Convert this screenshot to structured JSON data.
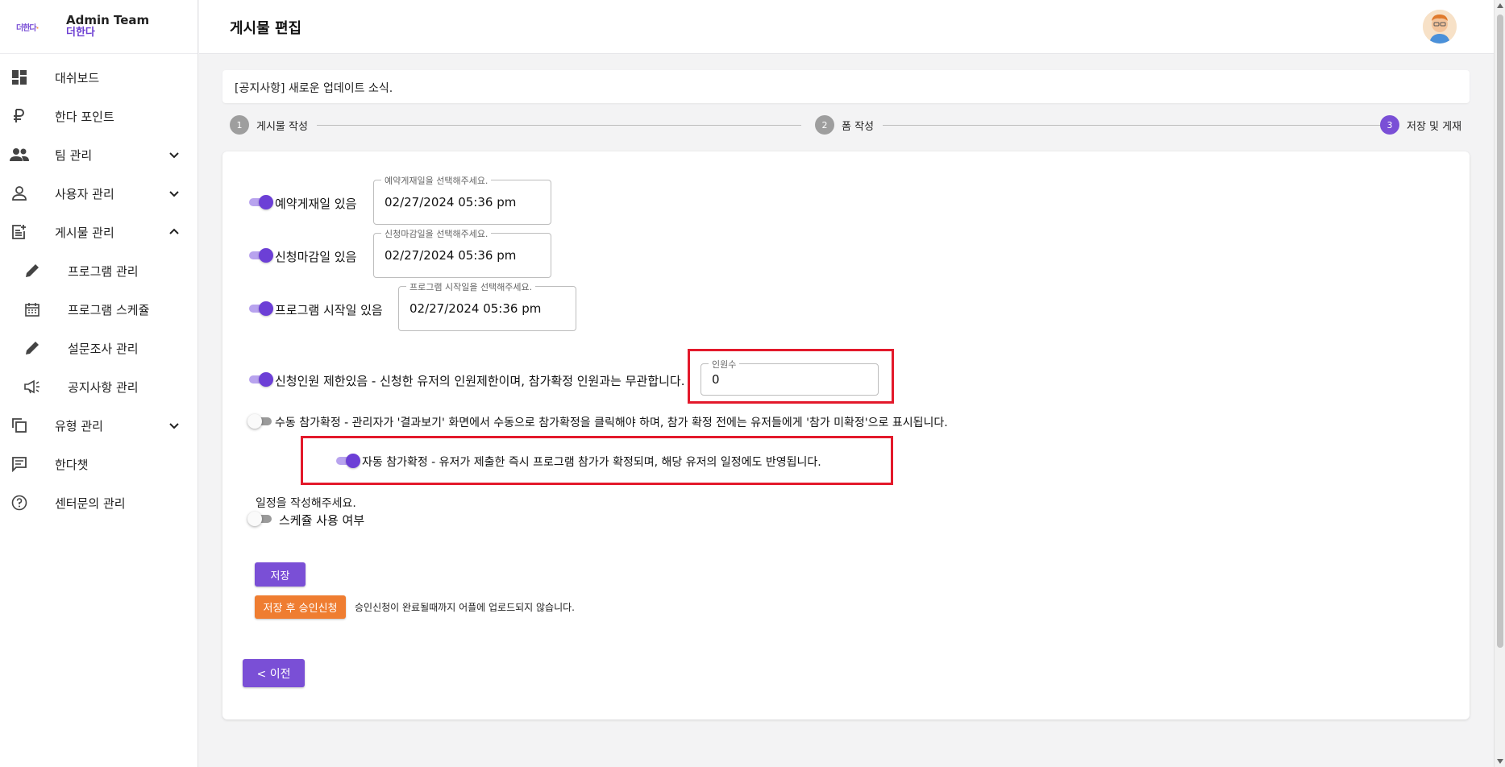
{
  "brand": {
    "logo_text": "더한다",
    "title": "Admin Team",
    "subtitle": "더한다"
  },
  "sidebar": {
    "items": [
      {
        "label": "대쉬보드",
        "icon": "dashboard-icon"
      },
      {
        "label": "한다 포인트",
        "icon": "ruble-icon"
      },
      {
        "label": "팀 관리",
        "icon": "people-icon",
        "chevron": "down"
      },
      {
        "label": "사용자 관리",
        "icon": "person-icon",
        "chevron": "down"
      },
      {
        "label": "게시물 관리",
        "icon": "post-add-icon",
        "chevron": "up"
      },
      {
        "label": "프로그램 관리",
        "icon": "pencil-icon"
      },
      {
        "label": "프로그램 스케쥴",
        "icon": "calendar-icon"
      },
      {
        "label": "설문조사 관리",
        "icon": "pencil-icon"
      },
      {
        "label": "공지사항 관리",
        "icon": "megaphone-icon"
      },
      {
        "label": "유형 관리",
        "icon": "copy-icon",
        "chevron": "down"
      },
      {
        "label": "한다챗",
        "icon": "chat-icon"
      },
      {
        "label": "센터문의 관리",
        "icon": "help-icon"
      }
    ]
  },
  "header": {
    "title": "게시물 편집"
  },
  "post": {
    "title": "[공지사항] 새로운 업데이트 소식."
  },
  "stepper": {
    "steps": [
      {
        "num": "1",
        "label": "게시물 작성",
        "active": false
      },
      {
        "num": "2",
        "label": "폼 작성",
        "active": false
      },
      {
        "num": "3",
        "label": "저장 및 게재",
        "active": true
      }
    ]
  },
  "form": {
    "reserve": {
      "toggle_on": true,
      "label": "예약게재일 있음",
      "field_legend": "예약게재일을 선택해주세요.",
      "value": "02/27/2024 05:36 pm"
    },
    "deadline": {
      "toggle_on": true,
      "label": "신청마감일 있음",
      "field_legend": "신청마감일을 선택해주세요.",
      "value": "02/27/2024 05:36 pm"
    },
    "start": {
      "toggle_on": true,
      "label": "프로그램 시작일 있음",
      "field_legend": "프로그램 시작일을 선택해주세요.",
      "value": "02/27/2024 05:36 pm"
    },
    "limit": {
      "toggle_on": true,
      "label": "신청인원 제한있음 - 신청한 유저의 인원제한이며, 참가확정 인원과는 무관합니다.",
      "field_legend": "인원수",
      "value": "0"
    },
    "manual": {
      "toggle_on": false,
      "label": "수동 참가확정 - 관리자가 '결과보기' 화면에서 수동으로 참가확정을 클릭해야 하며, 참가 확정 전에는 유저들에게 '참가 미확정'으로 표시됩니다."
    },
    "auto": {
      "toggle_on": true,
      "label": "자동 참가확정 - 유저가 제출한 즉시 프로그램 참가가 확정되며, 해당 유저의 일정에도 반영됩니다."
    },
    "schedule_hint": "일정을 작성해주세요.",
    "schedule": {
      "toggle_on": false,
      "label": "스케쥴 사용 여부"
    }
  },
  "actions": {
    "save_label": "저장",
    "save_approve_label": "저장 후 승인신청",
    "approval_note": "승인신청이 완료될때까지 어플에 업로드되지 않습니다.",
    "prev_label": "< 이전"
  },
  "colors": {
    "accent": "#7a4fd6",
    "orange": "#ef7d31",
    "highlight": "#e3192b"
  }
}
